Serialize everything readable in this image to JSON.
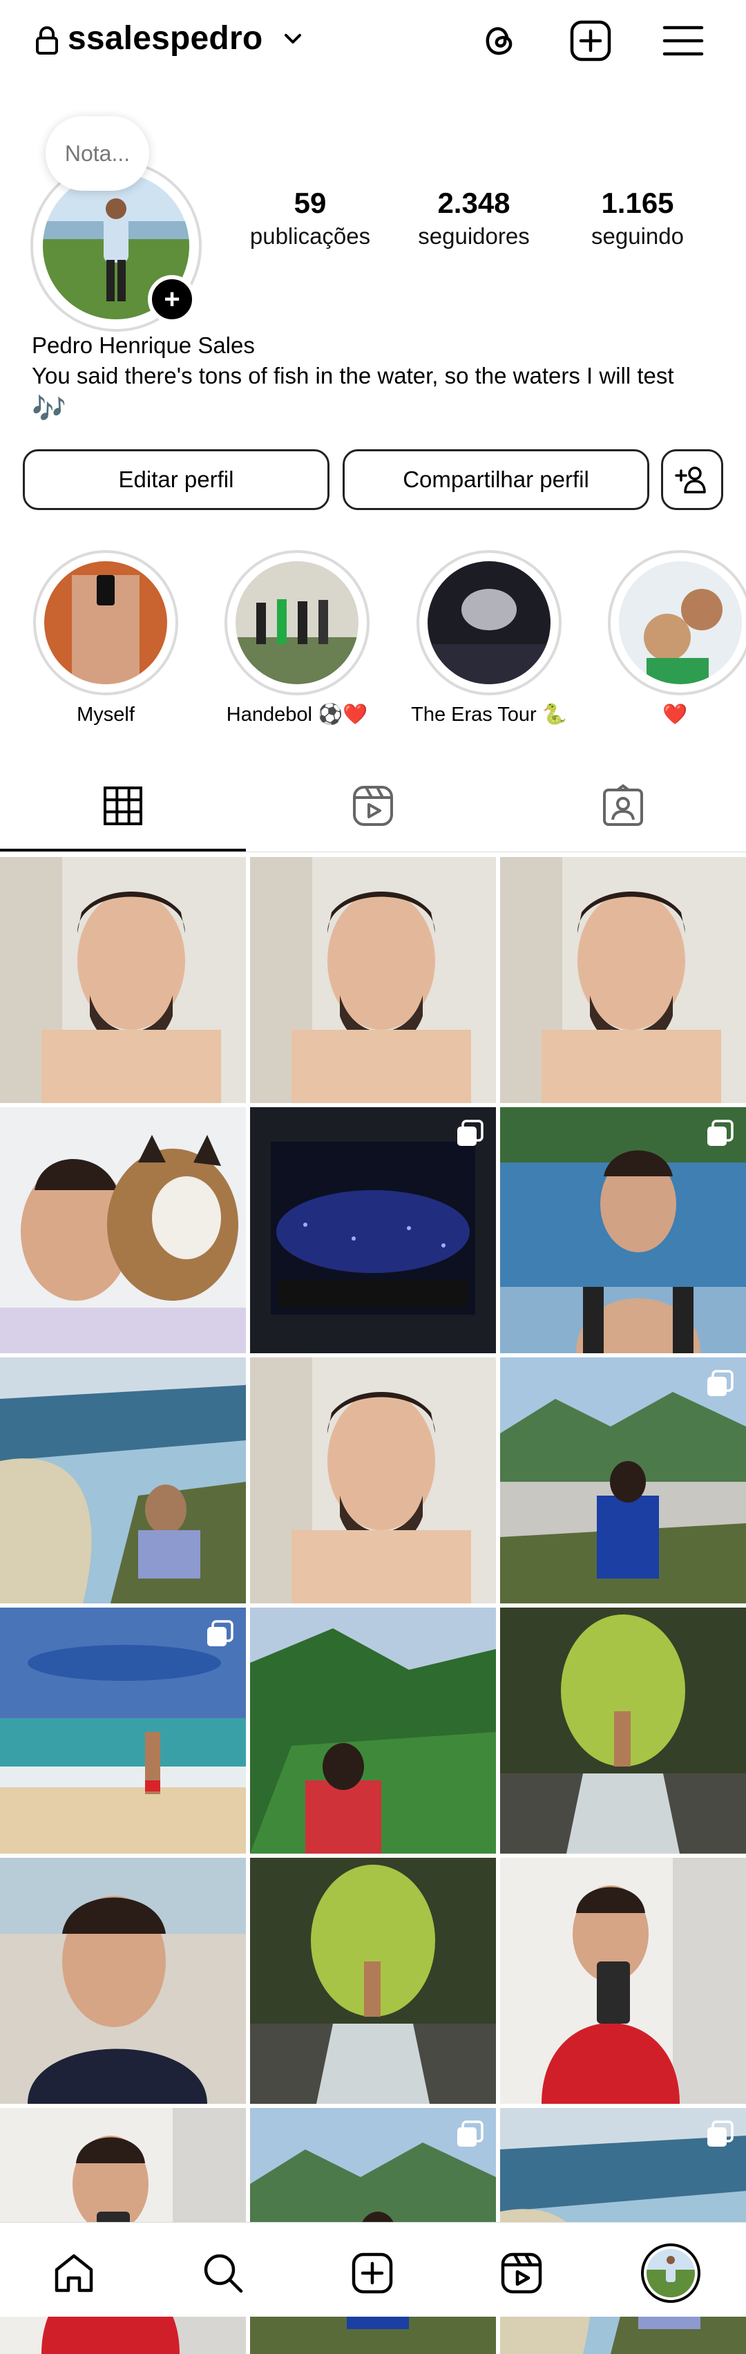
{
  "header": {
    "username": "ssalespedro"
  },
  "profile": {
    "note_placeholder": "Nota...",
    "stats": [
      {
        "value": "59",
        "label": "publicações"
      },
      {
        "value": "2.348",
        "label": "seguidores"
      },
      {
        "value": "1.165",
        "label": "seguindo"
      }
    ],
    "full_name": "Pedro Henrique Sales",
    "bio": "You said there's tons of fish in the water, so the waters I will test",
    "bio_emoji": "🎶"
  },
  "actions": {
    "edit_label": "Editar perfil",
    "share_label": "Compartilhar perfil"
  },
  "highlights": [
    {
      "label": "Myself"
    },
    {
      "label": "Handebol ⚽❤️"
    },
    {
      "label": "The Eras Tour 🐍"
    },
    {
      "label": "❤️"
    }
  ],
  "tabs": [
    "posts-grid-icon",
    "reels-icon",
    "tagged-icon"
  ],
  "grid": {
    "posts": [
      {
        "type": "portrait",
        "multi": false
      },
      {
        "type": "portrait",
        "multi": false
      },
      {
        "type": "portrait",
        "multi": false
      },
      {
        "type": "portrait-cat",
        "multi": false
      },
      {
        "type": "concert",
        "multi": true
      },
      {
        "type": "portrait-outdoor",
        "multi": true
      },
      {
        "type": "coast",
        "multi": false
      },
      {
        "type": "portrait",
        "multi": false
      },
      {
        "type": "mountain-view",
        "multi": true
      },
      {
        "type": "beach",
        "multi": true
      },
      {
        "type": "forest",
        "multi": false
      },
      {
        "type": "waterfall",
        "multi": false
      },
      {
        "type": "portrait-beach",
        "multi": false
      },
      {
        "type": "waterfall",
        "multi": false
      },
      {
        "type": "mirror-selfie",
        "multi": false
      },
      {
        "type": "mirror-selfie",
        "multi": false
      },
      {
        "type": "mountain-view",
        "multi": true
      },
      {
        "type": "coast",
        "multi": true
      }
    ]
  },
  "bottom_nav": [
    "home-icon",
    "search-icon",
    "create-icon",
    "reels-icon",
    "profile-avatar"
  ]
}
